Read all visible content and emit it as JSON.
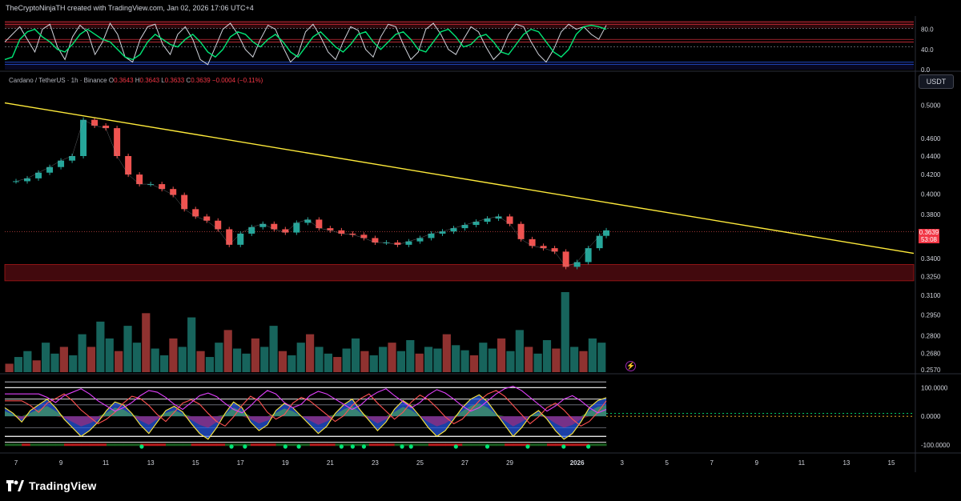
{
  "header": {
    "caption": "TheCryptoNinjaTH created with TradingView.com, Jan 02, 2026 17:06 UTC+4"
  },
  "symbol": {
    "name": "Cardano / TetherUS · 1h · Binance",
    "open_label": "O",
    "open": "0.3643",
    "high_label": "H",
    "high": "0.3643",
    "low_label": "L",
    "low": "0.3633",
    "close_label": "C",
    "close": "0.3639",
    "change": "−0.0004 (−0.11%)"
  },
  "currency_button": "USDT",
  "last_price": {
    "value": "0.3639",
    "countdown": "53:08",
    "color": "#f23645"
  },
  "branding": {
    "logo_text": "TradingView"
  },
  "colors": {
    "up": "#26a69a",
    "down": "#ef5350",
    "trendline": "#ffeb3b",
    "rsi_fast": "#d1d4dc",
    "rsi_slow": "#00e676",
    "support_zone": "#4a0a0f"
  },
  "chart_data": [
    {
      "type": "line",
      "pane": "oscillator-top",
      "ylim": [
        0,
        100
      ],
      "y_ticks": [
        "80.0",
        "40.0",
        "0.0"
      ],
      "y_tick_values": [
        80,
        40,
        0
      ],
      "levels": [
        95,
        90,
        82,
        60,
        55,
        45,
        15,
        10
      ],
      "series": [
        {
          "values": [
            55,
            70,
            85,
            60,
            35,
            80,
            90,
            45,
            20,
            65,
            88,
            75,
            30,
            55,
            92,
            70,
            25,
            15,
            60,
            85,
            90,
            50,
            30,
            70,
            85,
            60,
            20,
            10,
            45,
            80,
            92,
            70,
            40,
            25,
            60,
            88,
            80,
            45,
            15,
            30,
            75,
            90,
            65,
            35,
            20,
            55,
            85,
            78,
            40,
            25,
            65,
            90,
            85,
            50,
            20,
            35,
            80,
            92,
            70,
            40,
            30,
            60,
            85,
            75,
            45,
            20,
            35,
            70,
            90,
            85,
            55,
            30,
            15,
            40,
            75,
            90,
            80,
            85,
            70,
            60,
            88
          ]
        },
        {
          "values": [
            20,
            25,
            60,
            75,
            80,
            65,
            55,
            40,
            35,
            50,
            70,
            80,
            70,
            60,
            55,
            40,
            25,
            20,
            30,
            55,
            70,
            60,
            50,
            45,
            60,
            70,
            55,
            35,
            25,
            40,
            65,
            75,
            70,
            55,
            45,
            60,
            70,
            55,
            35,
            25,
            45,
            65,
            75,
            60,
            45,
            35,
            50,
            70,
            75,
            55,
            40,
            55,
            70,
            75,
            60,
            40,
            35,
            55,
            75,
            80,
            65,
            45,
            50,
            65,
            70,
            55,
            35,
            30,
            50,
            70,
            80,
            75,
            55,
            35,
            25,
            40,
            70,
            85,
            88,
            85,
            80
          ]
        }
      ]
    },
    {
      "type": "line",
      "pane": "price",
      "title": "Cardano / TetherUS · 1h · Binance",
      "y_scale": "log",
      "ylim": [
        0.255,
        0.52
      ],
      "y_ticks": [
        "0.5000",
        "0.4600",
        "0.4400",
        "0.4200",
        "0.4000",
        "0.3800",
        "0.3400",
        "0.3250",
        "0.3100",
        "0.2950",
        "0.2800",
        "0.2680",
        "0.2570"
      ],
      "y_tick_values": [
        0.5,
        0.46,
        0.44,
        0.42,
        0.4,
        0.38,
        0.34,
        0.325,
        0.31,
        0.295,
        0.28,
        0.268,
        0.257
      ],
      "x_ticks": [
        "7",
        "9",
        "11",
        "13",
        "15",
        "17",
        "19",
        "21",
        "23",
        "25",
        "27",
        "29",
        "2026",
        "3",
        "5",
        "7",
        "9",
        "11",
        "13",
        "15"
      ],
      "x_tick_values": [
        0,
        2,
        4,
        6,
        8,
        10,
        12,
        14,
        16,
        18,
        20,
        22,
        25,
        27,
        29,
        31,
        33,
        35,
        37,
        39
      ],
      "x_unit": "days from Dec 7, 2025 (2026 = Jan 1)",
      "x_range": [
        -0.5,
        40
      ],
      "series": [
        {
          "name": "ADA/USDT",
          "x": [
            0,
            0.5,
            1,
            1.5,
            2,
            2.5,
            3,
            3.5,
            4,
            4.5,
            5,
            5.5,
            6,
            6.5,
            7,
            7.5,
            8,
            8.5,
            9,
            9.5,
            10,
            10.5,
            11,
            11.5,
            12,
            12.5,
            13,
            13.5,
            14,
            14.5,
            15,
            15.5,
            16,
            16.5,
            17,
            17.5,
            18,
            18.5,
            19,
            19.5,
            20,
            20.5,
            21,
            21.5,
            22,
            22.5,
            23,
            23.5,
            24,
            24.5,
            25,
            25.5,
            26,
            26.3
          ],
          "values": [
            0.413,
            0.416,
            0.422,
            0.428,
            0.435,
            0.44,
            0.482,
            0.475,
            0.472,
            0.44,
            0.42,
            0.41,
            0.41,
            0.405,
            0.399,
            0.385,
            0.378,
            0.374,
            0.366,
            0.352,
            0.362,
            0.368,
            0.371,
            0.366,
            0.363,
            0.372,
            0.375,
            0.367,
            0.365,
            0.362,
            0.361,
            0.358,
            0.354,
            0.354,
            0.352,
            0.355,
            0.358,
            0.362,
            0.364,
            0.367,
            0.37,
            0.373,
            0.376,
            0.378,
            0.371,
            0.357,
            0.351,
            0.349,
            0.346,
            0.333,
            0.337,
            0.349,
            0.36,
            0.365
          ]
        }
      ],
      "trendline": {
        "x": [
          -0.5,
          40
        ],
        "values": [
          0.503,
          0.3445
        ]
      },
      "support_zone": [
        0.3215,
        0.335
      ],
      "last_price": 0.3639
    },
    {
      "type": "bar",
      "pane": "volume",
      "note": "relative volume, overlaid at bottom of price pane",
      "values": [
        10,
        18,
        25,
        14,
        35,
        22,
        30,
        20,
        45,
        30,
        60,
        40,
        25,
        55,
        35,
        70,
        28,
        20,
        40,
        30,
        65,
        25,
        18,
        35,
        50,
        28,
        22,
        40,
        30,
        55,
        25,
        20,
        35,
        45,
        30,
        22,
        18,
        28,
        40,
        25,
        20,
        30,
        35,
        25,
        38,
        22,
        30,
        28,
        45,
        32,
        26,
        20,
        35,
        28,
        40,
        25,
        50,
        30,
        22,
        38,
        28,
        95,
        30,
        25,
        40,
        35
      ]
    },
    {
      "type": "area",
      "pane": "oscillator-bottom",
      "ylim": [
        -100,
        140
      ],
      "y_ticks": [
        "100.0000",
        "0.0000",
        "-100.0000"
      ],
      "y_tick_values": [
        100,
        0,
        -100
      ],
      "levels": [
        120,
        100,
        60,
        40,
        -40,
        -70,
        -90
      ],
      "series": [
        {
          "name": "",
          "values": [
            30,
            10,
            -20,
            20,
            40,
            60,
            30,
            -10,
            -40,
            -70,
            -50,
            -20,
            20,
            50,
            40,
            10,
            -30,
            -60,
            -20,
            20,
            35,
            15,
            -25,
            -60,
            -80,
            -40,
            10,
            50,
            30,
            -20,
            -50,
            -30,
            20,
            45,
            30,
            0,
            -30,
            -60,
            -35,
            10,
            40,
            60,
            20,
            -15,
            -50,
            -20,
            25,
            55,
            35,
            0,
            -40,
            -70,
            -50,
            -10,
            30,
            60,
            75,
            50,
            10,
            -30,
            -70,
            -40,
            0,
            20,
            -10,
            -50,
            -80,
            -60,
            -20,
            30,
            55,
            65
          ]
        }
      ],
      "signal_dots_x": [
        5.6,
        9.6,
        10.2,
        12,
        12.6,
        14.5,
        15,
        15.5,
        17.2,
        17.6,
        19.6,
        21,
        22.8,
        24.4,
        25.5
      ]
    }
  ]
}
